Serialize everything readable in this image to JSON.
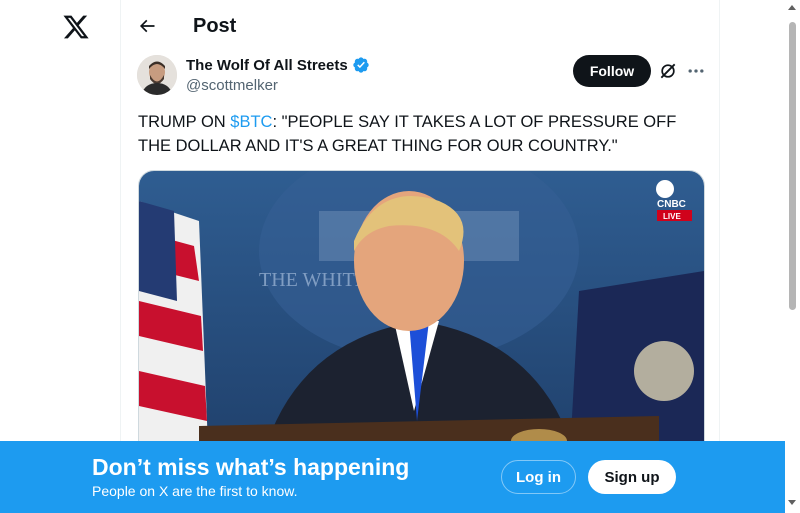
{
  "header": {
    "title": "Post"
  },
  "author": {
    "name": "The Wolf Of All Streets",
    "handle": "@scottmelker"
  },
  "actions": {
    "follow_label": "Follow"
  },
  "post": {
    "text_before": "TRUMP ON ",
    "cashtag": "$BTC",
    "text_after": ": \"PEOPLE SAY IT TAKES A LOT OF PRESSURE OFF THE DOLLAR AND IT'S A GREAT THING FOR OUR COUNTRY.\""
  },
  "media": {
    "network_label": "CNBC",
    "live_label": "LIVE",
    "backdrop_text": "THE WHITE HOUSE"
  },
  "banner": {
    "title": "Don’t miss what’s happening",
    "subtitle": "People on X are the first to know.",
    "login_label": "Log in",
    "signup_label": "Sign up"
  },
  "colors": {
    "accent": "#1d9bf0",
    "text": "#0f1419",
    "secondary": "#536471"
  },
  "icons": [
    "x-logo-icon",
    "back-arrow-icon",
    "verified-badge-icon",
    "grok-icon",
    "more-icon"
  ]
}
